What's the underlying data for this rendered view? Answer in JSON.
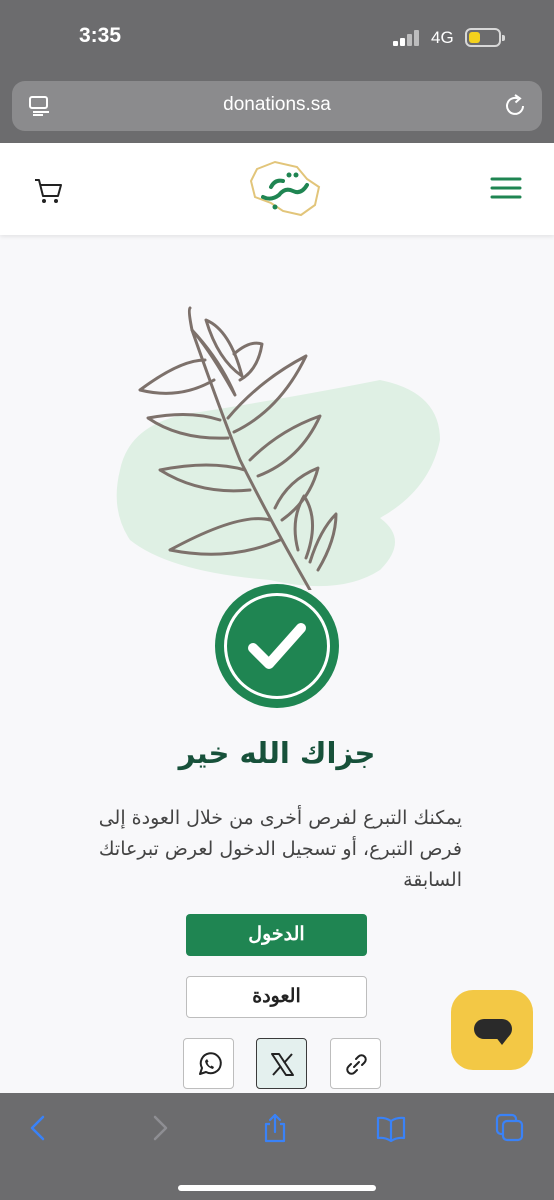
{
  "status_bar": {
    "time": "3:35",
    "network": "4G"
  },
  "browser": {
    "url": "donations.sa"
  },
  "header": {
    "logo_text": "تبرع"
  },
  "confirmation": {
    "title": "جزاك الله خير",
    "message": "يمكنك التبرع لفرص أخرى من خلال العودة إلى فرص التبرع، أو تسجيل الدخول لعرض تبرعاتك السابقة"
  },
  "actions": {
    "login_label": "الدخول",
    "back_label": "العودة"
  },
  "colors": {
    "primary_green": "#1f8552",
    "dark_green": "#17513a",
    "chat_yellow": "#f3c845",
    "ios_blue": "#3a82f7"
  },
  "icons": {
    "share": [
      "whatsapp-icon",
      "x-icon",
      "link-icon"
    ],
    "toolbar": [
      "back-chevron-icon",
      "forward-chevron-icon",
      "share-icon",
      "bookmarks-icon",
      "tabs-icon"
    ]
  }
}
